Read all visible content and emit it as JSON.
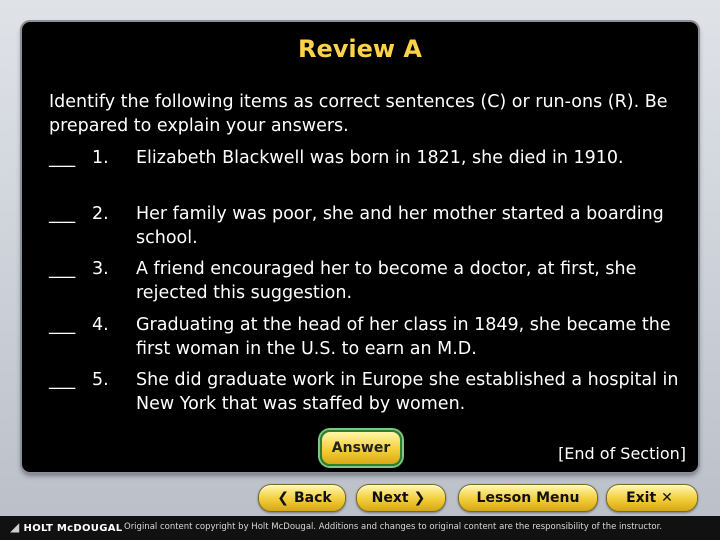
{
  "slide": {
    "title": "Review A",
    "intro": "Identify the following items as correct sentences (C) or run-ons (R). Be prepared to explain your answers.",
    "items": [
      {
        "blank": "___",
        "num": "1.",
        "text": "Elizabeth Blackwell was born in 1821, she died in 1910."
      },
      {
        "blank": "___",
        "num": "2.",
        "text": "Her family was poor, she and her mother started a boarding school."
      },
      {
        "blank": "___",
        "num": "3.",
        "text": "A friend encouraged her to become a doctor, at first, she rejected this suggestion."
      },
      {
        "blank": "___",
        "num": "4.",
        "text": "Graduating at the head of her class in 1849, she became the first woman in the U.S. to earn an M.D."
      },
      {
        "blank": "___",
        "num": "5.",
        "text": "She did graduate work in Europe she established a hospital in New York that was staffed by women."
      }
    ],
    "answer_label": "Answer",
    "end_label": "[End of Section]"
  },
  "nav": {
    "back": "Back",
    "next": "Next",
    "menu": "Lesson Menu",
    "exit": "Exit"
  },
  "icons": {
    "back": "chevron-left-icon",
    "next": "chevron-right-icon",
    "exit": "close-icon"
  },
  "footer": {
    "logo": "HOLT McDOUGAL",
    "copyright": "Original content copyright by Holt McDougal. Additions and changes to original content are the responsibility of the instructor."
  },
  "colors": {
    "title": "#ffd24a",
    "slide_bg": "#000000",
    "button": "#f2cd3a"
  }
}
